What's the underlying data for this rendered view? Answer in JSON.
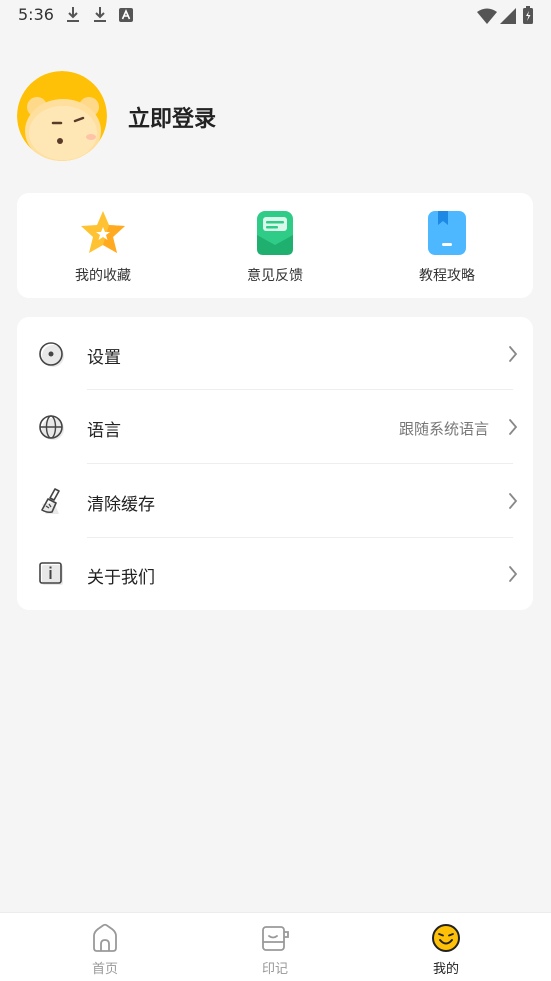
{
  "status_bar": {
    "time": "5:36",
    "icons": [
      "download-icon",
      "download-icon",
      "font-icon",
      "wifi-icon",
      "signal-icon",
      "battery-icon"
    ]
  },
  "profile": {
    "avatar_icon": "bear-avatar",
    "login_label": "立即登录"
  },
  "quick_actions": [
    {
      "label": "我的收藏",
      "icon": "star-icon"
    },
    {
      "label": "意见反馈",
      "icon": "feedback-icon"
    },
    {
      "label": "教程攻略",
      "icon": "bookmark-book-icon"
    }
  ],
  "menu": [
    {
      "label": "设置",
      "icon": "settings-icon",
      "value": ""
    },
    {
      "label": "语言",
      "icon": "globe-icon",
      "value": "跟随系统语言"
    },
    {
      "label": "清除缓存",
      "icon": "brush-icon",
      "value": ""
    },
    {
      "label": "关于我们",
      "icon": "info-icon",
      "value": ""
    }
  ],
  "bottom_nav": [
    {
      "label": "首页",
      "icon": "home-icon",
      "active": false
    },
    {
      "label": "印记",
      "icon": "notebook-icon",
      "active": false
    },
    {
      "label": "我的",
      "icon": "face-icon",
      "active": true
    }
  ],
  "colors": {
    "background": "#f5f5f5",
    "card": "#ffffff",
    "avatar_yellow": "#ffc107",
    "feedback_green": "#2ecc87",
    "tutorial_blue": "#4db8ff",
    "star_orange": "#ffb300"
  }
}
